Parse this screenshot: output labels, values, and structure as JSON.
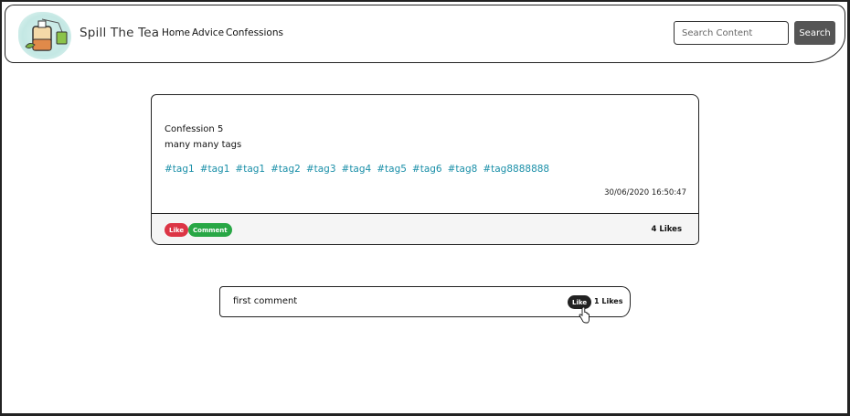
{
  "header": {
    "brand": "Spill The Tea",
    "nav": [
      "Home",
      "Advice",
      "Confessions"
    ],
    "search": {
      "placeholder": "Search Content",
      "button_label": "Search"
    }
  },
  "confession": {
    "title": "Confession 5",
    "body": "many many tags",
    "tags": [
      "#tag1",
      "#tag1",
      "#tag1",
      "#tag2",
      "#tag3",
      "#tag4",
      "#tag5",
      "#tag6",
      "#tag8",
      "#tag8888888"
    ],
    "timestamp": "30/06/2020 16:50:47",
    "like_label": "Like",
    "comment_label": "Comment",
    "likes": "4 Likes"
  },
  "comment": {
    "text": "first comment",
    "like_label": "Like",
    "likes": "1 Likes"
  },
  "colors": {
    "tag": "#1a8fa8",
    "like_button": "#dc3545",
    "comment_button": "#28a745",
    "search_button": "#555555",
    "comment_like_button": "#222222"
  }
}
